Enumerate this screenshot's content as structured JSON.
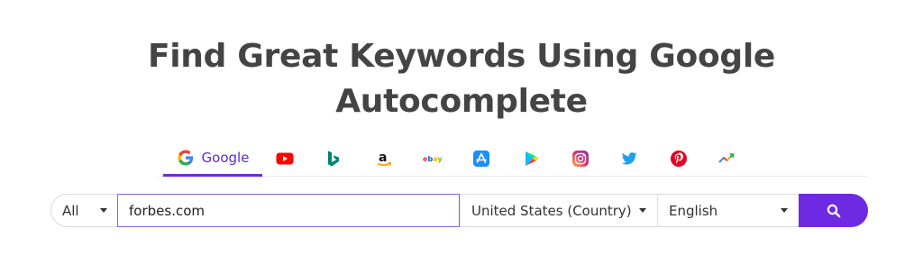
{
  "page": {
    "title_line1": "Find Great Keywords Using Google",
    "title_line2": "Autocomplete"
  },
  "tabs": [
    {
      "label": "Google",
      "icon": "google-icon",
      "active": true
    },
    {
      "label": "",
      "icon": "youtube-icon"
    },
    {
      "label": "",
      "icon": "bing-icon"
    },
    {
      "label": "",
      "icon": "amazon-icon"
    },
    {
      "label": "",
      "icon": "ebay-icon"
    },
    {
      "label": "",
      "icon": "app-store-icon"
    },
    {
      "label": "",
      "icon": "google-play-icon"
    },
    {
      "label": "",
      "icon": "instagram-icon"
    },
    {
      "label": "",
      "icon": "twitter-icon"
    },
    {
      "label": "",
      "icon": "pinterest-icon"
    },
    {
      "label": "",
      "icon": "trends-icon"
    }
  ],
  "search": {
    "scope": "All",
    "query": "forbes.com",
    "country": "United States (Country)",
    "language": "English",
    "button_icon": "search-icon"
  },
  "colors": {
    "accent": "#6d2ae2",
    "title": "#444444",
    "youtube": "#ff0000",
    "bing": "#008373",
    "twitter": "#1da1f2",
    "pinterest": "#e60023"
  }
}
